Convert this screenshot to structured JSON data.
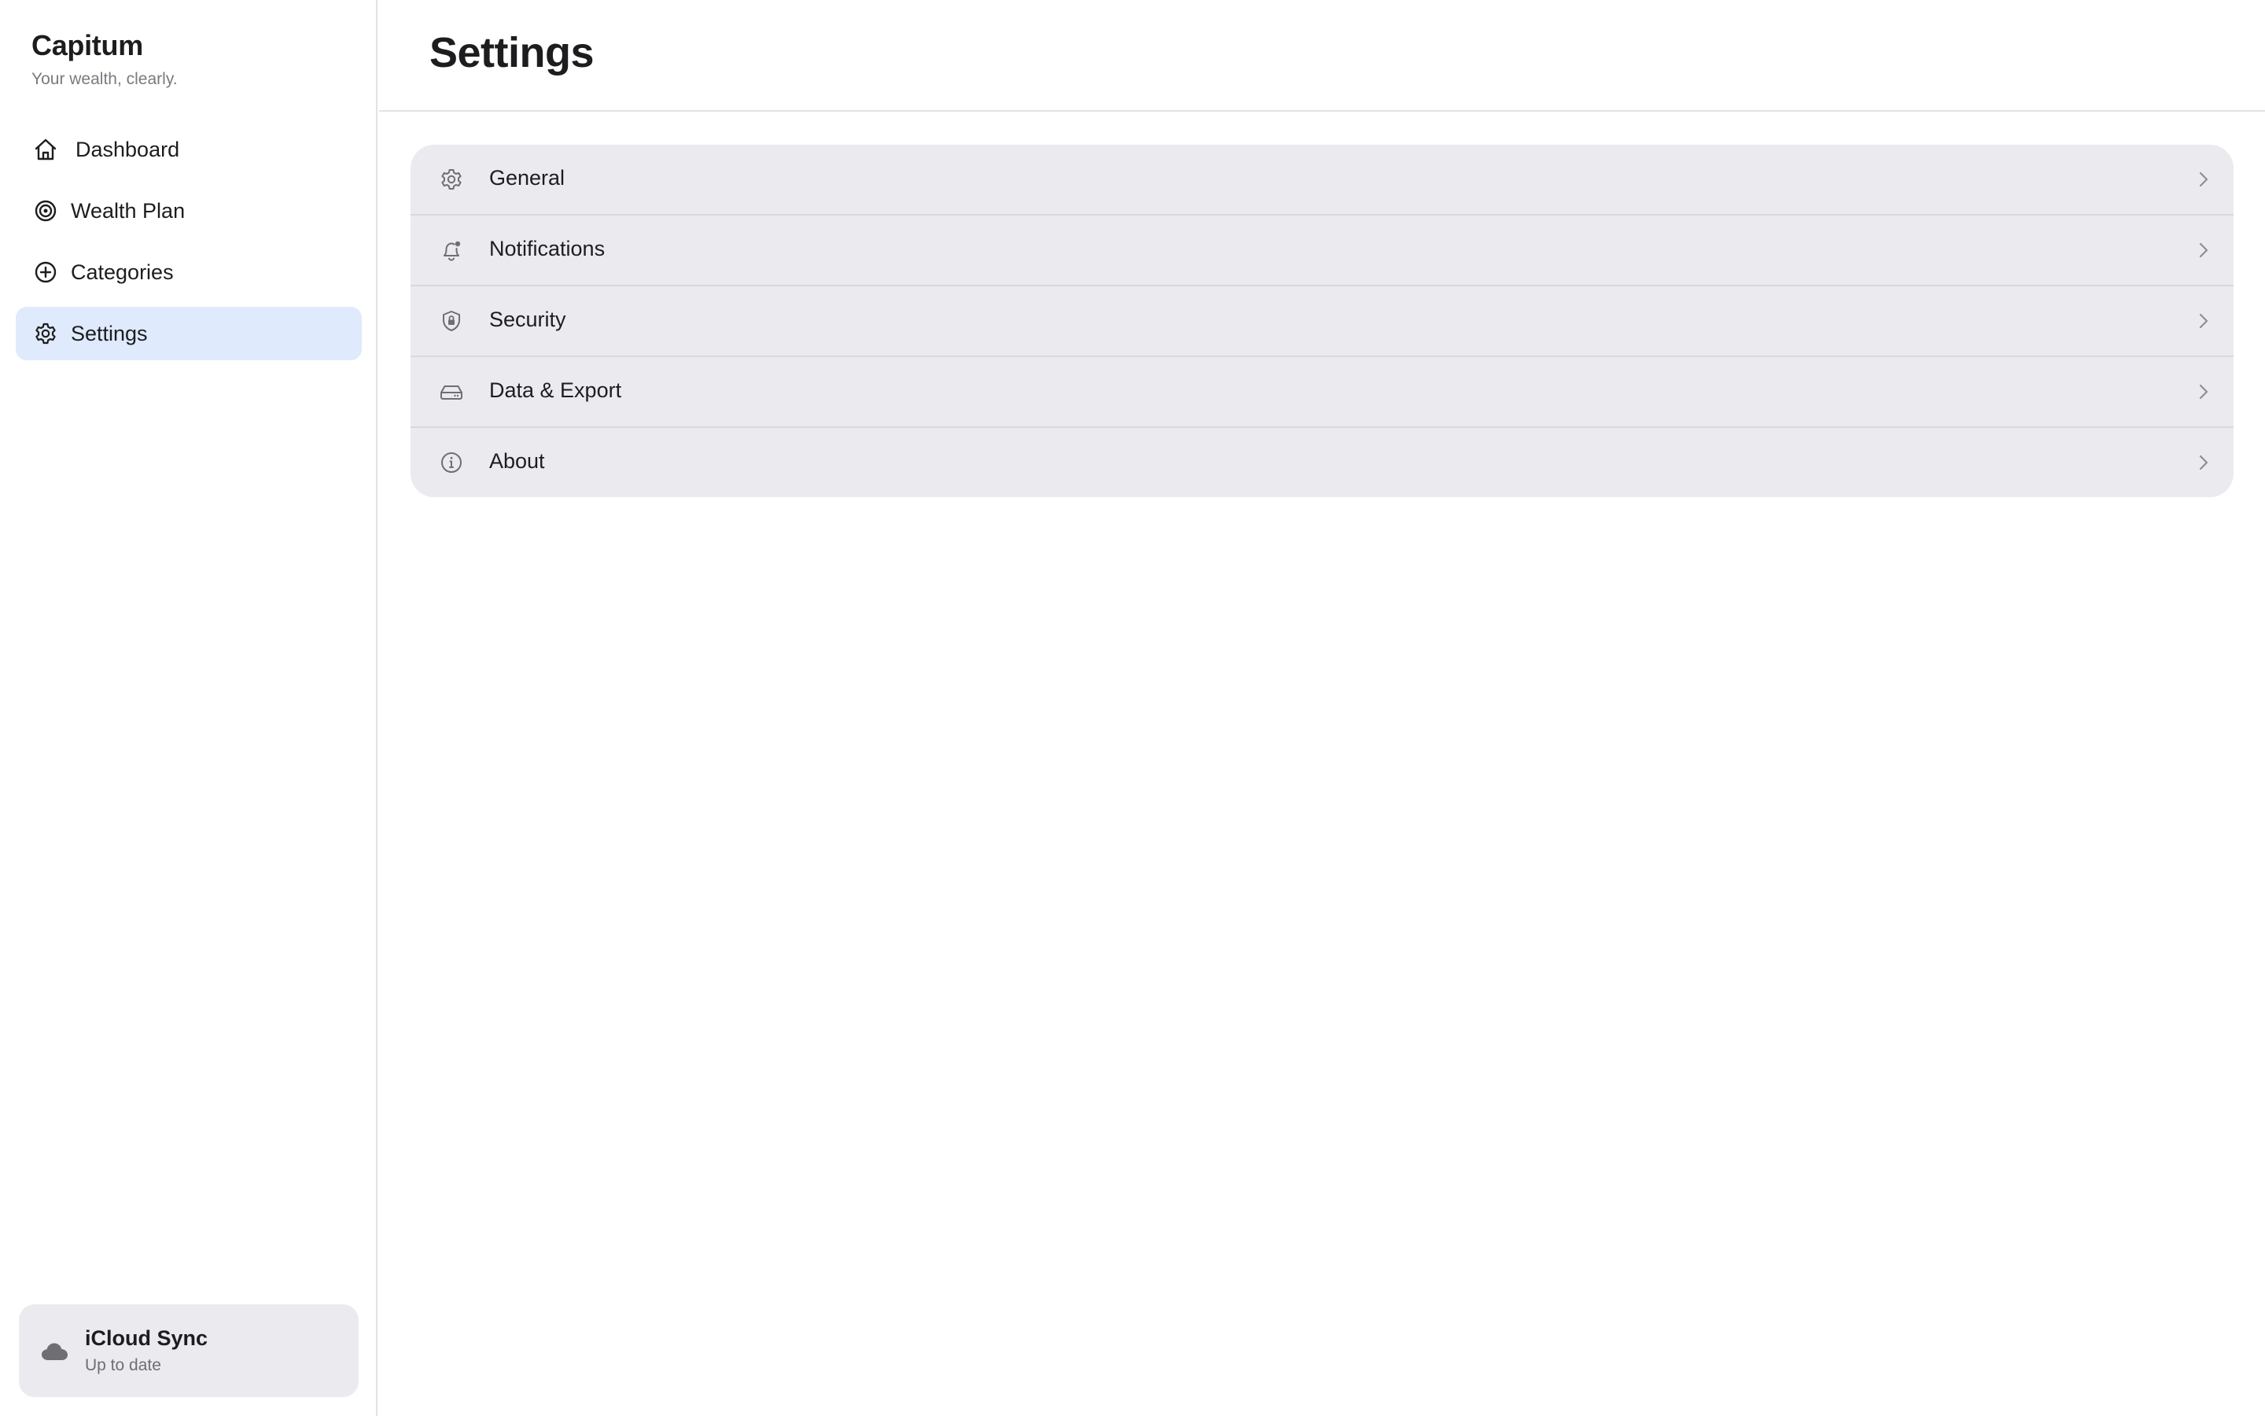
{
  "app": {
    "name": "Capitum",
    "tagline": "Your wealth, clearly."
  },
  "sidebar": {
    "items": [
      {
        "label": "Dashboard",
        "icon": "house-icon",
        "active": false
      },
      {
        "label": "Wealth Plan",
        "icon": "target-icon",
        "active": false
      },
      {
        "label": "Categories",
        "icon": "plus-circle-icon",
        "active": false
      },
      {
        "label": "Settings",
        "icon": "gear-icon",
        "active": true
      }
    ],
    "sync": {
      "title": "iCloud Sync",
      "status": "Up to date",
      "icon": "cloud-icon"
    }
  },
  "main": {
    "title": "Settings",
    "rows": [
      {
        "label": "General",
        "icon": "gear-icon"
      },
      {
        "label": "Notifications",
        "icon": "bell-badge-icon"
      },
      {
        "label": "Security",
        "icon": "shield-lock-icon"
      },
      {
        "label": "Data & Export",
        "icon": "drive-icon"
      },
      {
        "label": "About",
        "icon": "info-circle-icon"
      }
    ]
  },
  "colors": {
    "accent_active_bg": "#dfeafd",
    "list_bg": "#ebeaef",
    "sync_card_bg": "#ebebef",
    "text_primary": "#1d1d1f",
    "text_secondary": "#7a7a80"
  }
}
